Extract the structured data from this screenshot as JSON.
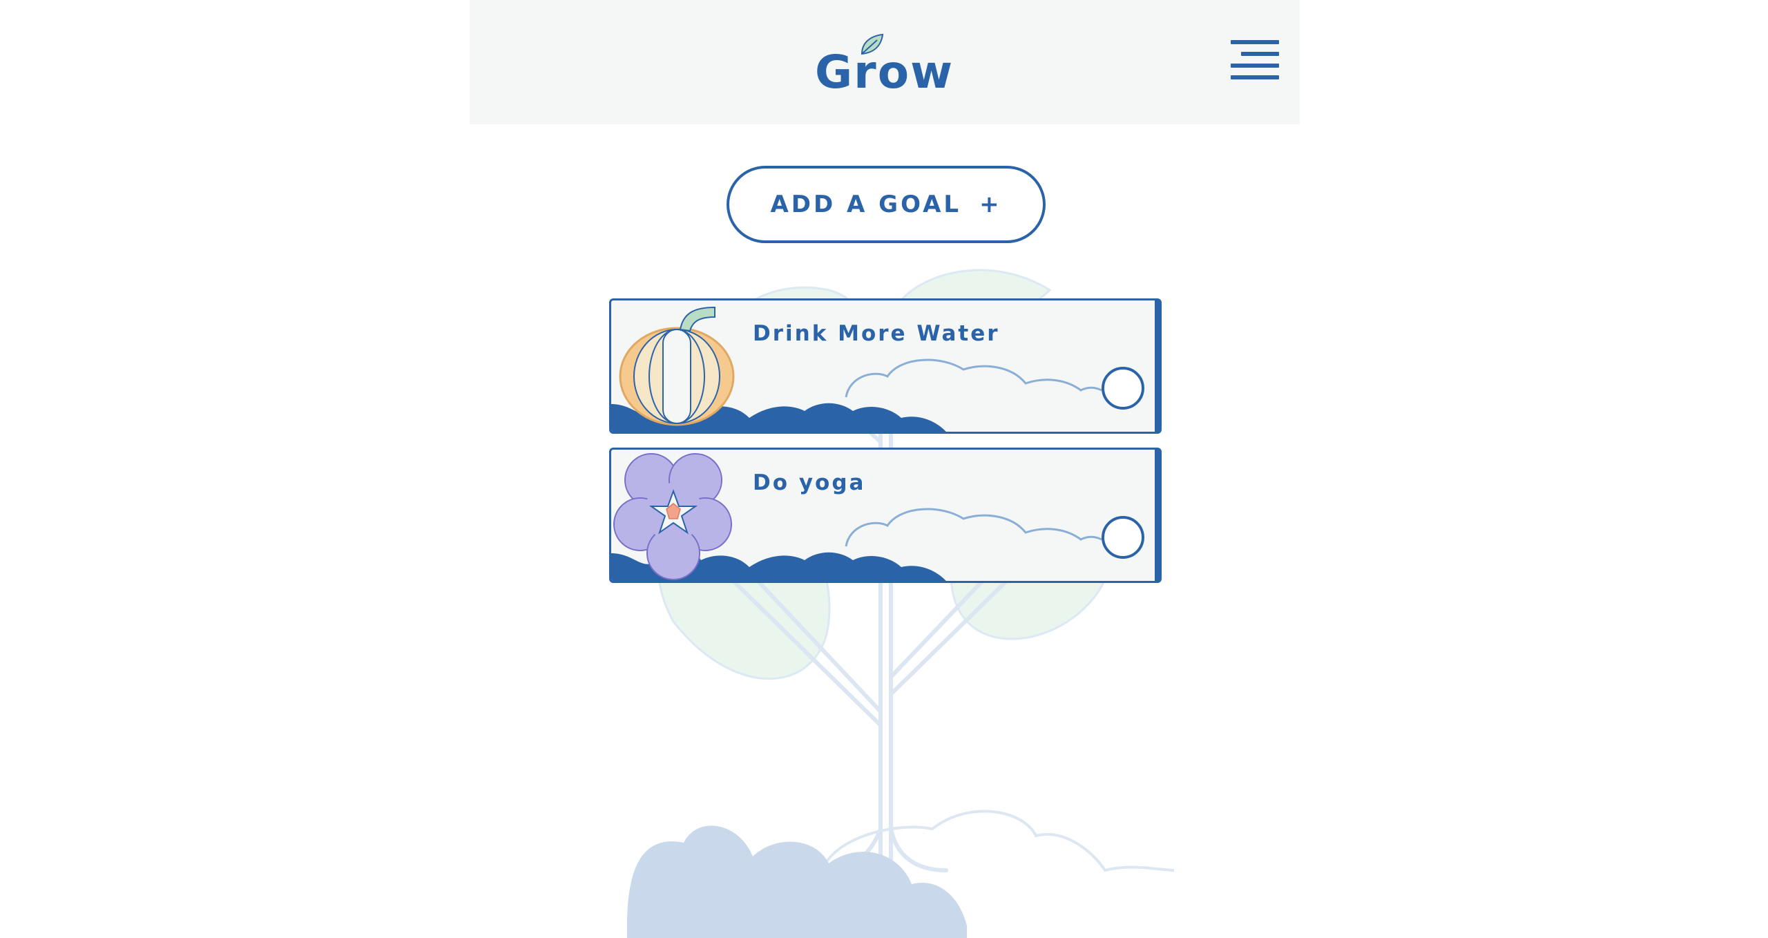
{
  "header": {
    "logo_text": "Grow",
    "menu_icon": "hamburger-menu-icon"
  },
  "actions": {
    "add_goal_label": "ADD A GOAL",
    "add_goal_icon": "+"
  },
  "goals": [
    {
      "title": "Drink More Water",
      "plant_icon": "pumpkin-icon",
      "completed": false
    },
    {
      "title": "Do yoga",
      "plant_icon": "flower-icon",
      "completed": false
    }
  ],
  "colors": {
    "primary": "#2a63a8",
    "header_bg": "#f5f7f6",
    "card_bg": "#f5f7f6",
    "hill_dark": "#2a63a8",
    "hill_light": "#c9d8ea",
    "leaf_green": "#eaf5ee",
    "pumpkin": "#f6c98f",
    "flower": "#b9b4e8"
  }
}
